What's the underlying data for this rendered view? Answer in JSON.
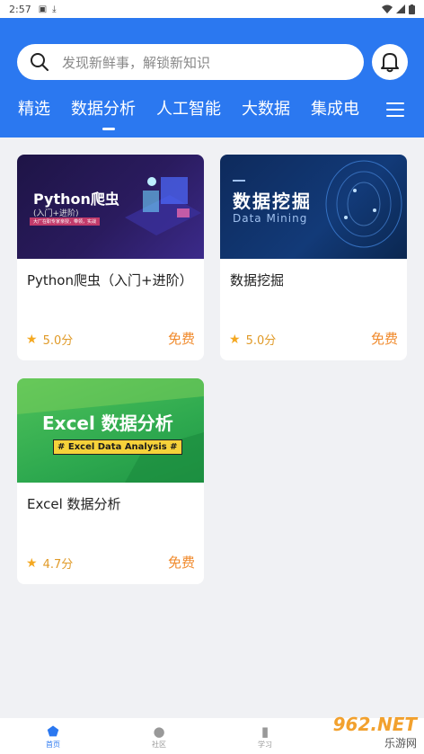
{
  "status_bar": {
    "time": "2:57",
    "icons": [
      "a-icon",
      "download-icon",
      "wifi-icon",
      "signal-icon",
      "battery-icon"
    ]
  },
  "search": {
    "placeholder": "发现新鲜事，解锁新知识"
  },
  "tabs": [
    "精选",
    "数据分析",
    "人工智能",
    "大数据",
    "集成电"
  ],
  "active_tab": "数据分析",
  "courses": [
    {
      "title": "Python爬虫（入门+进阶）",
      "rating": "5.0分",
      "price": "免费",
      "thumb": {
        "line1": "Python爬虫",
        "line2": "(入门+进阶)",
        "line3": "大厂在职专家亲授，带领，实战"
      }
    },
    {
      "title": "数据挖掘",
      "rating": "5.0分",
      "price": "免费",
      "thumb": {
        "line1": "数据挖掘",
        "line2": "Data Mining"
      }
    },
    {
      "title": "Excel 数据分析",
      "rating": "4.7分",
      "price": "免费",
      "thumb": {
        "line1": "Excel 数据分析",
        "line2": "# Excel Data Analysis #"
      }
    }
  ],
  "bottom_nav": [
    {
      "label": "首页",
      "icon": "home-icon"
    },
    {
      "label": "社区",
      "icon": "planet-icon"
    },
    {
      "label": "学习",
      "icon": "book-icon"
    }
  ],
  "watermark": {
    "line1": "962.NET",
    "line2": "乐游网"
  },
  "colors": {
    "primary": "#2b78f0",
    "price": "#f08a2c",
    "star": "#f4a821",
    "background": "#f0f1f4"
  }
}
